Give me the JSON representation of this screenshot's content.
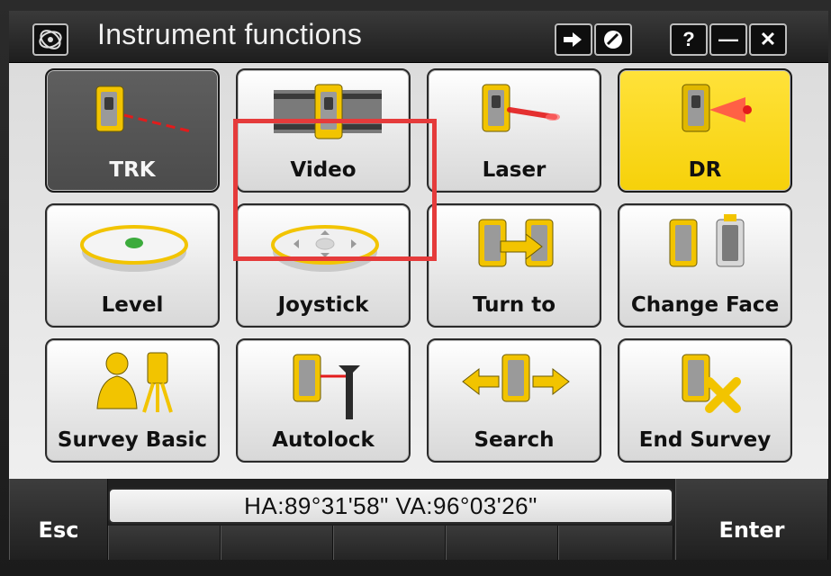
{
  "window": {
    "title": "Instrument functions",
    "buttons": [
      {
        "name": "login-button",
        "label": ""
      },
      {
        "name": "settings-button",
        "label": ""
      },
      {
        "name": "help-button",
        "label": "?"
      },
      {
        "name": "minimize-button",
        "label": "—"
      },
      {
        "name": "close-button",
        "label": "✕"
      }
    ]
  },
  "tiles": [
    {
      "label": "TRK",
      "state": "active-dark",
      "icon": "instrument-laser-beam-icon"
    },
    {
      "label": "Video",
      "state": "normal",
      "icon": "instrument-filmstrip-icon"
    },
    {
      "label": "Laser",
      "state": "normal",
      "icon": "instrument-laser-pointer-icon"
    },
    {
      "label": "DR",
      "state": "active-yellow",
      "icon": "instrument-dr-beam-icon"
    },
    {
      "label": "Level",
      "state": "normal",
      "icon": "level-bubble-icon"
    },
    {
      "label": "Joystick",
      "state": "normal",
      "icon": "joystick-pad-icon"
    },
    {
      "label": "Turn to",
      "state": "normal",
      "icon": "turn-to-arrow-icon"
    },
    {
      "label": "Change Face",
      "state": "normal",
      "icon": "change-face-icon"
    },
    {
      "label": "Survey Basic",
      "state": "normal",
      "icon": "survey-basic-person-icon"
    },
    {
      "label": "Autolock",
      "state": "normal",
      "icon": "autolock-prism-icon"
    },
    {
      "label": "Search",
      "state": "normal",
      "icon": "search-arrows-icon"
    },
    {
      "label": "End Survey",
      "state": "normal",
      "icon": "end-survey-x-icon"
    }
  ],
  "status": {
    "coords": "HA:89°31'58\"  VA:96°03'26\""
  },
  "softkeys": {
    "esc": "Esc",
    "enter": "Enter"
  },
  "colors": {
    "accent_yellow": "#f6d10a",
    "highlight_red": "#e53b3b",
    "laser_red": "#e31b1b"
  }
}
